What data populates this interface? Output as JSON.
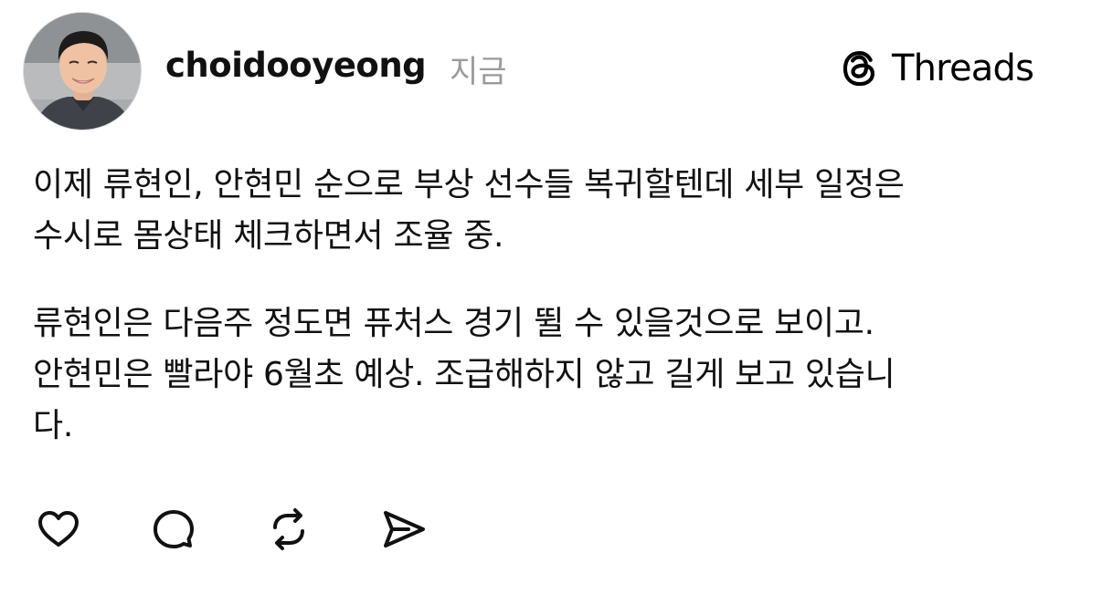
{
  "post": {
    "author": {
      "username": "choidooyeong",
      "avatar_icon": "profile-photo"
    },
    "timestamp": "지금",
    "brand": {
      "name": "Threads",
      "icon": "threads-logo-icon"
    },
    "paragraphs": [
      {
        "lines": [
          "이제 류현인, 안현민 순으로 부상 선수들 복귀할텐데 세부 일정은",
          "수시로 몸상태 체크하면서 조율 중."
        ]
      },
      {
        "lines": [
          "류현인은 다음주 정도면 퓨처스 경기 뛸 수 있을것으로 보이고.",
          "안현민은 빨라야 6월초 예상. 조급해하지 않고 길게 보고 있습니",
          "다."
        ]
      }
    ],
    "actions": [
      {
        "icon": "heart-icon"
      },
      {
        "icon": "comment-icon"
      },
      {
        "icon": "repost-icon"
      },
      {
        "icon": "share-icon"
      }
    ]
  },
  "colors": {
    "text": "#111111",
    "muted": "#9a9a9a",
    "background": "#ffffff"
  }
}
